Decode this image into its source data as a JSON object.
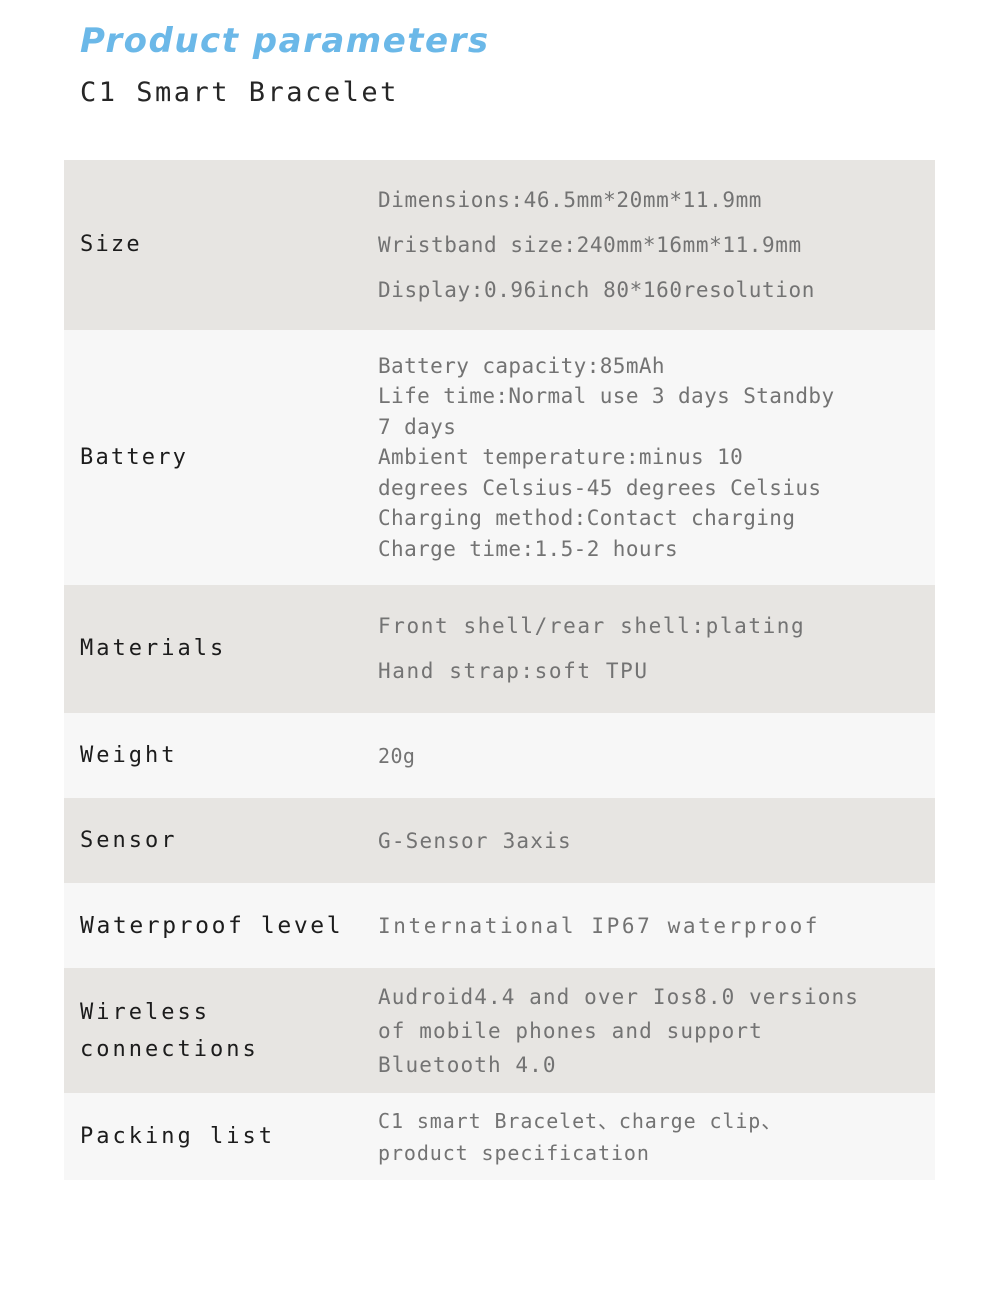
{
  "header": {
    "title": "Product parameters",
    "subtitle": "C1 Smart Bracelet",
    "title_color": "#6bb8e8",
    "subtitle_color": "#262626"
  },
  "table": {
    "row_shade_dark": "#e7e5e2",
    "row_shade_light": "#f7f7f7",
    "label_color": "#1c1c1c",
    "value_color": "#737373",
    "rows": [
      {
        "label": "Size",
        "value": "Dimensions:46.5mm*20mm*11.9mm\nWristband size:240mm*16mm*11.9mm\nDisplay:0.96inch 80*160resolution"
      },
      {
        "label": "Battery",
        "value": "Battery capacity:85mAh\nLife time:Normal use 3 days Standby\n7 days\nAmbient temperature:minus 10\ndegrees Celsius-45 degrees Celsius\nCharging method:Contact charging\nCharge time:1.5-2 hours"
      },
      {
        "label": "Materials",
        "value": "Front shell/rear shell:plating\nHand strap:soft TPU"
      },
      {
        "label": "Weight",
        "value": "20g"
      },
      {
        "label": "Sensor",
        "value": "G-Sensor 3axis"
      },
      {
        "label": "Waterproof level",
        "value": "International IP67 waterproof"
      },
      {
        "label": "Wireless\nconnections",
        "value": "Audroid4.4 and over Ios8.0 versions\nof mobile phones and support\nBluetooth 4.0"
      },
      {
        "label": "Packing list",
        "value": "C1 smart Bracelet、charge clip、\nproduct specification"
      }
    ]
  }
}
